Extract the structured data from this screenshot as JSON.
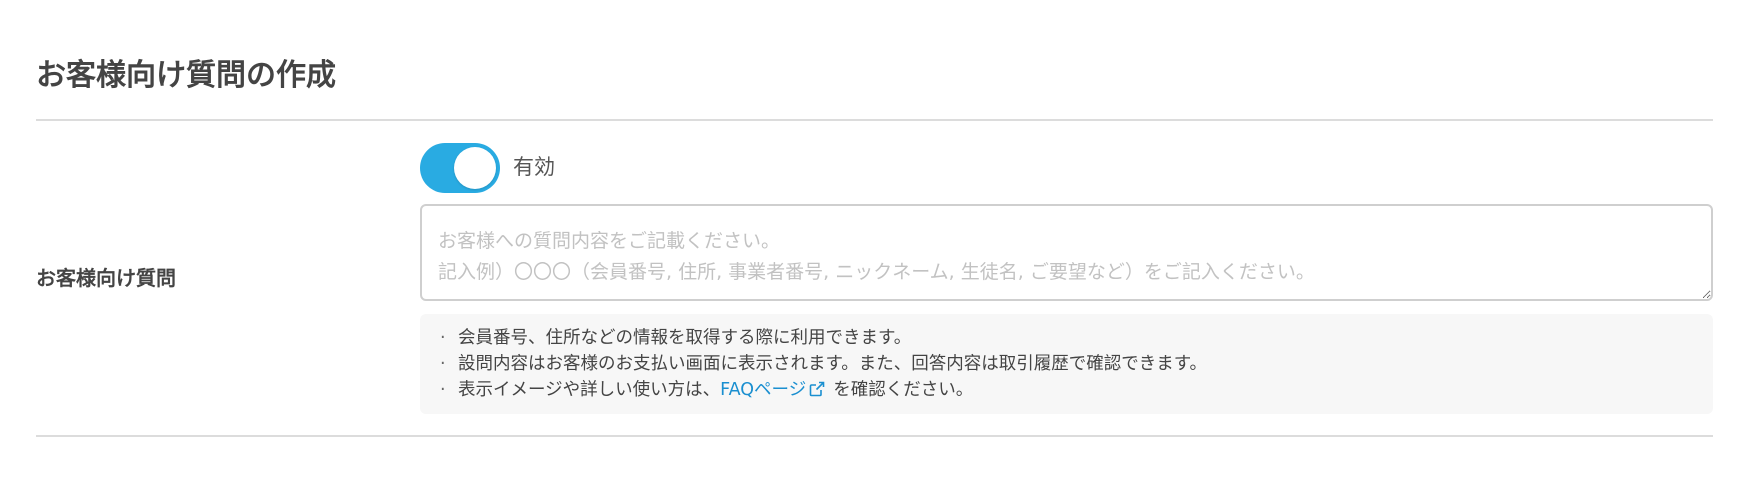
{
  "page": {
    "title": "お客様向け質問の作成"
  },
  "field": {
    "label": "お客様向け質問"
  },
  "toggle": {
    "state": "on",
    "label": "有効"
  },
  "textarea": {
    "value": "",
    "placeholder": "お客様への質問内容をご記載ください。\n記入例）〇〇〇（会員番号, 住所, 事業者番号, ニックネーム, 生徒名, ご要望など）をご記入ください。"
  },
  "help": {
    "items": [
      "会員番号、住所などの情報を取得する際に利用できます。",
      "設問内容はお客様のお支払い画面に表示されます。また、回答内容は取引履歴で確認できます。"
    ],
    "faq_prefix": "表示イメージや詳しい使い方は、",
    "faq_link_label": "FAQページ",
    "faq_suffix": "を確認ください。",
    "link_icon": "external-link-icon"
  },
  "colors": {
    "accent": "#29abe2",
    "link": "#1a8fd0",
    "help_background": "#f7f7f7",
    "divider": "#dcdcdc"
  }
}
